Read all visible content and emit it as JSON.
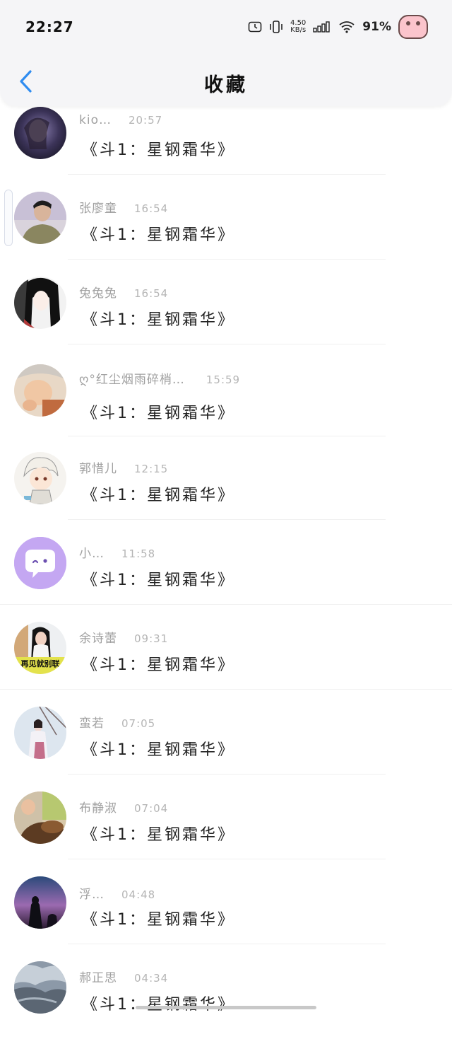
{
  "status_bar": {
    "time": "22:27",
    "net_speed_value": "4.50",
    "net_speed_unit": "KB/s",
    "battery": "91%"
  },
  "header": {
    "title": "收藏",
    "back_icon": "chevron-left-icon"
  },
  "colors": {
    "accent": "#2f8cf0",
    "name_gray": "#a0a0a0",
    "purple_avatar": "#c4a7f2"
  },
  "items": [
    {
      "name": "kio…",
      "time": "20:57",
      "message": "《斗1：星钢霜华》"
    },
    {
      "name": "张廖童",
      "time": "16:54",
      "message": "《斗1：星钢霜华》"
    },
    {
      "name": "兔兔兔",
      "time": "16:54",
      "message": "《斗1：星钢霜华》"
    },
    {
      "name": "ღ°红尘烟雨碎梢…",
      "time": "15:59",
      "message": "《斗1：星钢霜华》"
    },
    {
      "name": "郭惜儿",
      "time": "12:15",
      "message": "《斗1：星钢霜华》"
    },
    {
      "name": "小…",
      "time": "11:58",
      "message": "《斗1：星钢霜华》"
    },
    {
      "name": "余诗蕾",
      "time": "09:31",
      "message": "《斗1：星钢霜华》",
      "avatar_caption": "再见就别联"
    },
    {
      "name": "蛮若",
      "time": "07:05",
      "message": "《斗1：星钢霜华》"
    },
    {
      "name": "布静淑",
      "time": "07:04",
      "message": "《斗1：星钢霜华》"
    },
    {
      "name": "浮…",
      "time": "04:48",
      "message": "《斗1：星钢霜华》"
    },
    {
      "name": "郝正思",
      "time": "04:34",
      "message": "《斗1：星钢霜华》"
    }
  ]
}
